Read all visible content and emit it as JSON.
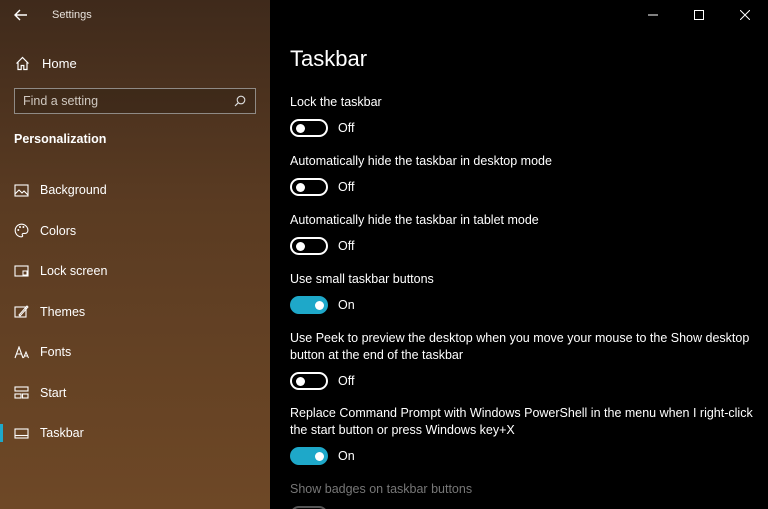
{
  "window": {
    "app_title": "Settings"
  },
  "sidebar": {
    "home_label": "Home",
    "search_placeholder": "Find a setting",
    "section_title": "Personalization",
    "items": [
      {
        "label": "Background",
        "icon": "picture-icon"
      },
      {
        "label": "Colors",
        "icon": "palette-icon"
      },
      {
        "label": "Lock screen",
        "icon": "lock-screen-icon"
      },
      {
        "label": "Themes",
        "icon": "brush-icon"
      },
      {
        "label": "Fonts",
        "icon": "font-icon"
      },
      {
        "label": "Start",
        "icon": "start-icon"
      },
      {
        "label": "Taskbar",
        "icon": "taskbar-icon",
        "active": true
      }
    ]
  },
  "main": {
    "title": "Taskbar",
    "settings": [
      {
        "description": "Lock the taskbar",
        "state": "Off"
      },
      {
        "description": "Automatically hide the taskbar in desktop mode",
        "state": "Off"
      },
      {
        "description": "Automatically hide the taskbar in tablet mode",
        "state": "Off"
      },
      {
        "description": "Use small taskbar buttons",
        "state": "On"
      },
      {
        "description": "Use Peek to preview the desktop when you move your mouse to the Show desktop button at the end of the taskbar",
        "state": "Off"
      },
      {
        "description": "Replace Command Prompt with Windows PowerShell in the menu when I right-click the start button or press Windows key+X",
        "state": "On"
      },
      {
        "description": "Show badges on taskbar buttons",
        "state": ""
      }
    ]
  },
  "colors": {
    "accent": "#1ea8c9",
    "sidebar_start": "#3f2a1b",
    "sidebar_end": "#6e4826"
  }
}
